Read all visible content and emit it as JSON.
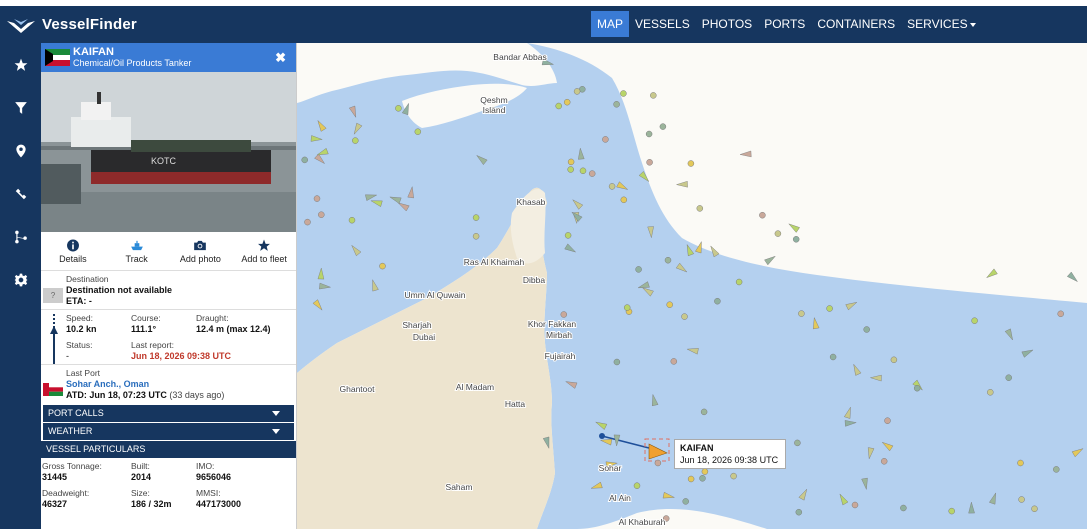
{
  "brand": {
    "name": "VesselFinder"
  },
  "nav": {
    "items": [
      {
        "label": "MAP",
        "active": true
      },
      {
        "label": "VESSELS"
      },
      {
        "label": "PHOTOS"
      },
      {
        "label": "PORTS"
      },
      {
        "label": "CONTAINERS"
      },
      {
        "label": "SERVICES"
      }
    ]
  },
  "toolbar": [
    "star-icon",
    "filter-icon",
    "pin-icon",
    "satellite-icon",
    "route-icon",
    "gear-icon"
  ],
  "vessel": {
    "name": "KAIFAN",
    "type": "Chemical/Oil Products Tanker",
    "flag": "Kuwait",
    "hull_text": "KOTC"
  },
  "actions": [
    {
      "label": "Details",
      "icon": "info-icon"
    },
    {
      "label": "Track",
      "icon": "ship-icon"
    },
    {
      "label": "Add photo",
      "icon": "camera-icon"
    },
    {
      "label": "Add to fleet",
      "icon": "star-icon"
    }
  ],
  "destination": {
    "label": "Destination",
    "value": "Destination not available",
    "eta": "ETA: -",
    "badge": "?"
  },
  "speed": {
    "label": "Speed:",
    "value": "10.2 kn"
  },
  "course": {
    "label": "Course:",
    "value": "111.1°"
  },
  "draught": {
    "label": "Draught:",
    "value": "12.4 m (max 12.4)"
  },
  "status": {
    "label": "Status:",
    "value": "-"
  },
  "last_report": {
    "label": "Last report:",
    "value": "Jun 18, 2026 09:38 UTC"
  },
  "last_port": {
    "label": "Last Port",
    "name": "Sohar Anch., Oman",
    "atd": "ATD: Jun 18, 07:23 UTC",
    "ago": "(33 days ago)"
  },
  "sections": {
    "port_calls": "PORT CALLS",
    "weather": "WEATHER",
    "particulars": "VESSEL PARTICULARS"
  },
  "particulars": {
    "gross_tonnage_label": "Gross Tonnage:",
    "gross_tonnage": "31445",
    "built_label": "Built:",
    "built": "2014",
    "imo_label": "IMO:",
    "imo": "9656046",
    "deadweight_label": "Deadweight:",
    "deadweight": "46327",
    "size_label": "Size:",
    "size": "186 / 32m",
    "mmsi_label": "MMSI:",
    "mmsi": "447173000"
  },
  "map": {
    "places": [
      "Bandar Abbas",
      "Qeshm Island",
      "Khasab",
      "Ras Al Khaimah",
      "Umm Al Quwain",
      "Dibba",
      "Sharjah",
      "Dubai",
      "Khor Fakkan",
      "Mirbah",
      "Fujairah",
      "Ghantoot",
      "Al Madam",
      "Hatta",
      "Sohar",
      "Al Ain",
      "Saham",
      "Al Khaburah"
    ],
    "popup_name": "KAIFAN",
    "popup_time": "Jun 18, 2026 09:38 UTC",
    "colors": {
      "water": "#b4d0ef",
      "land": "#fbfaf6",
      "desert": "#ede4cf",
      "nav": "#16365f",
      "accent": "#3a7bd5"
    }
  }
}
